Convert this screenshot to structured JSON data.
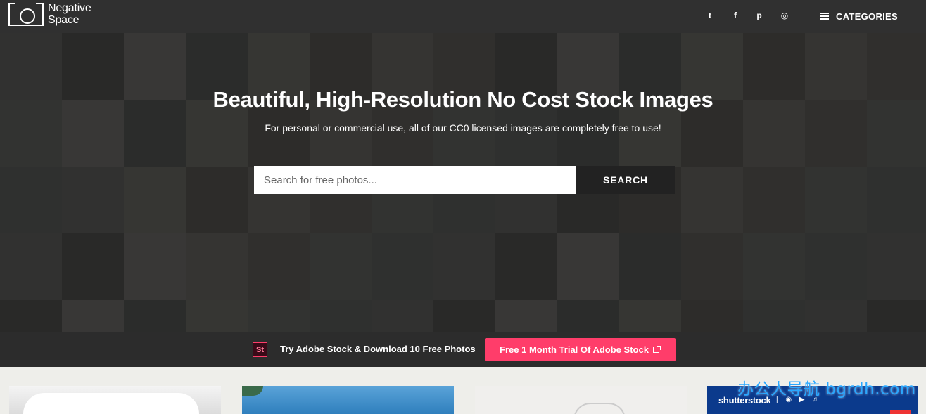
{
  "header": {
    "logo_line1": "Negative",
    "logo_line2": "Space",
    "social": [
      {
        "name": "twitter-icon",
        "glyph": "t"
      },
      {
        "name": "facebook-icon",
        "glyph": "f"
      },
      {
        "name": "pinterest-icon",
        "glyph": "p"
      },
      {
        "name": "instagram-icon",
        "glyph": "◎"
      }
    ],
    "categories_label": "CATEGORIES"
  },
  "hero": {
    "title": "Beautiful, High-Resolution No Cost Stock Images",
    "subtitle": "For personal or commercial use, all of our CC0 licensed images are completely free to use!",
    "search": {
      "placeholder": "Search for free photos...",
      "value": "",
      "button_label": "SEARCH"
    }
  },
  "promo": {
    "icon_text": "St",
    "text": "Try Adobe Stock & Download 10 Free Photos",
    "button_label": "Free 1 Month Trial Of Adobe Stock"
  },
  "cards": {
    "ad_brand": "shutterstock",
    "ad_separator": "|",
    "ad_icons": "◉ ▶ ♫"
  },
  "watermark": "办公人导航 bgrdh.com",
  "colors": {
    "header_bg": "#303030",
    "accent": "#ff3d6a",
    "search_button_bg": "#222222",
    "promo_bg": "#2c2c2c",
    "page_bg": "#eeeeea"
  }
}
